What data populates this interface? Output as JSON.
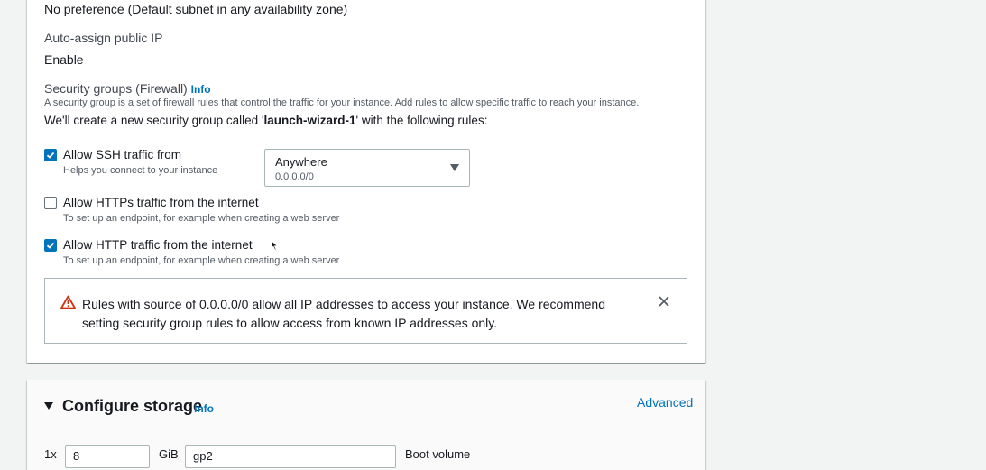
{
  "network": {
    "subnet_value": "No preference (Default subnet in any availability zone)",
    "auto_assign_label": "Auto-assign public IP",
    "auto_assign_value": "Enable",
    "sg_label": "Security groups (Firewall)",
    "sg_info": "Info",
    "sg_desc": "A security group is a set of firewall rules that control the traffic for your instance. Add rules to allow specific traffic to reach your instance.",
    "sg_create_prefix": "We'll create a new security group called '",
    "sg_create_name": "launch-wizard-1",
    "sg_create_suffix": "' with the following rules:",
    "rules": [
      {
        "label": "Allow SSH traffic from",
        "desc": "Helps you connect to your instance",
        "checked": true
      },
      {
        "label": "Allow HTTPs traffic from the internet",
        "desc": "To set up an endpoint, for example when creating a web server",
        "checked": false
      },
      {
        "label": "Allow HTTP traffic from the internet",
        "desc": "To set up an endpoint, for example when creating a web server",
        "checked": true
      }
    ],
    "ssh_source": {
      "value": "Anywhere",
      "sub": "0.0.0.0/0"
    },
    "alert_text": "Rules with source of 0.0.0.0/0 allow all IP addresses to access your instance. We recommend setting security group rules to allow access from known IP addresses only."
  },
  "storage": {
    "title": "Configure storage",
    "info": "Info",
    "advanced": "Advanced",
    "count_prefix": "1x",
    "size_value": "8",
    "unit": "GiB",
    "volume_type": "gp2",
    "volume_label": "Boot volume"
  },
  "colors": {
    "accent": "#0073bb",
    "warning": "#d13212",
    "background": "#f2f3f3"
  }
}
